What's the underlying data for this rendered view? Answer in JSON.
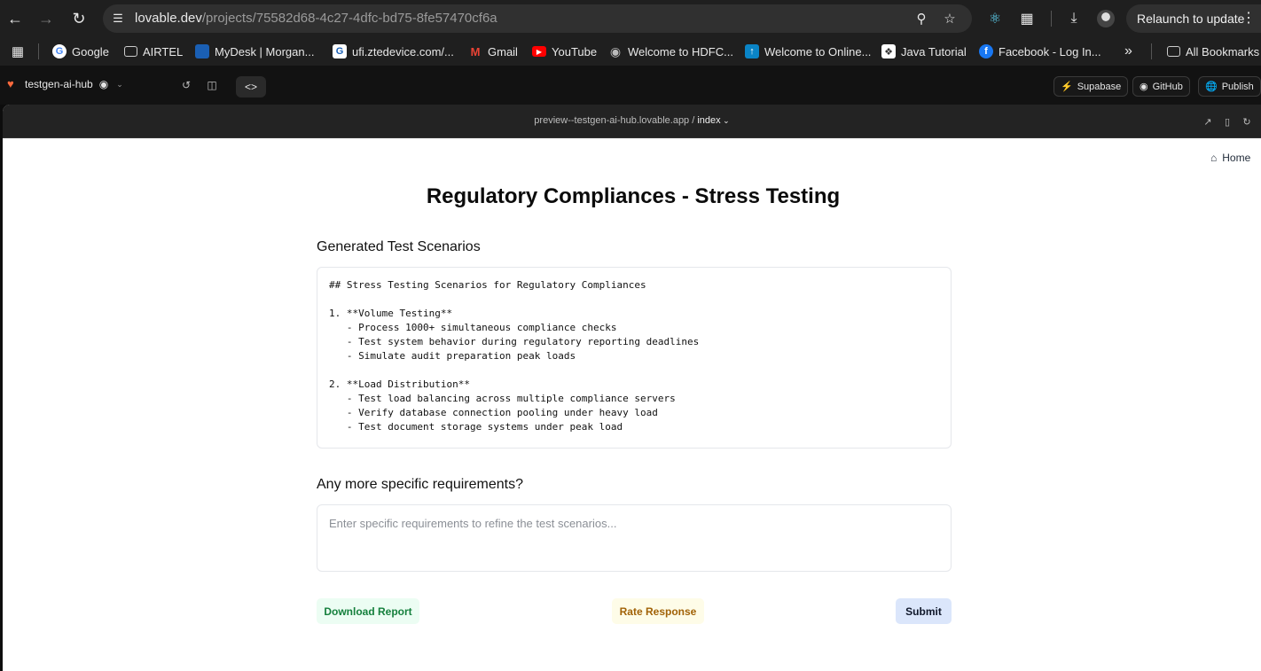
{
  "browser": {
    "url_host": "lovable.dev",
    "url_path": "/projects/75582d68-4c27-4dfc-bd75-8fe57470cf6a",
    "relaunch_label": "Relaunch to update",
    "bookmarks": [
      "Google",
      "AIRTEL",
      "MyDesk | Morgan...",
      "ufi.ztedevice.com/...",
      "Gmail",
      "YouTube",
      "Welcome to HDFC...",
      "Welcome to Online...",
      "Java Tutorial",
      "Facebook - Log In..."
    ],
    "all_bookmarks_label": "All Bookmarks"
  },
  "app": {
    "project_name": "testgen-ai-hub",
    "supabase_label": "Supabase",
    "github_label": "GitHub",
    "publish_label": "Publish"
  },
  "preview": {
    "url": "preview--testgen-ai-hub.lovable.app /",
    "route": "index"
  },
  "page": {
    "home_label": "Home",
    "title": "Regulatory Compliances - Stress Testing",
    "scenarios_heading": "Generated Test Scenarios",
    "scenarios_text": "## Stress Testing Scenarios for Regulatory Compliances\n\n1. **Volume Testing**\n   - Process 1000+ simultaneous compliance checks\n   - Test system behavior during regulatory reporting deadlines\n   - Simulate audit preparation peak loads\n\n2. **Load Distribution**\n   - Test load balancing across multiple compliance servers\n   - Verify database connection pooling under heavy load\n   - Test document storage systems under peak load",
    "requirements_heading": "Any more specific requirements?",
    "requirements_placeholder": "Enter specific requirements to refine the test scenarios...",
    "requirements_value": "",
    "download_label": "Download Report",
    "rate_label": "Rate Response",
    "submit_label": "Submit"
  },
  "colors": {
    "download_bg": "#ecfdf3",
    "download_fg": "#15803d",
    "rate_bg": "#fefce8",
    "rate_fg": "#a16207",
    "submit_bg": "#dbe6fb",
    "submit_fg": "#0f172a"
  }
}
